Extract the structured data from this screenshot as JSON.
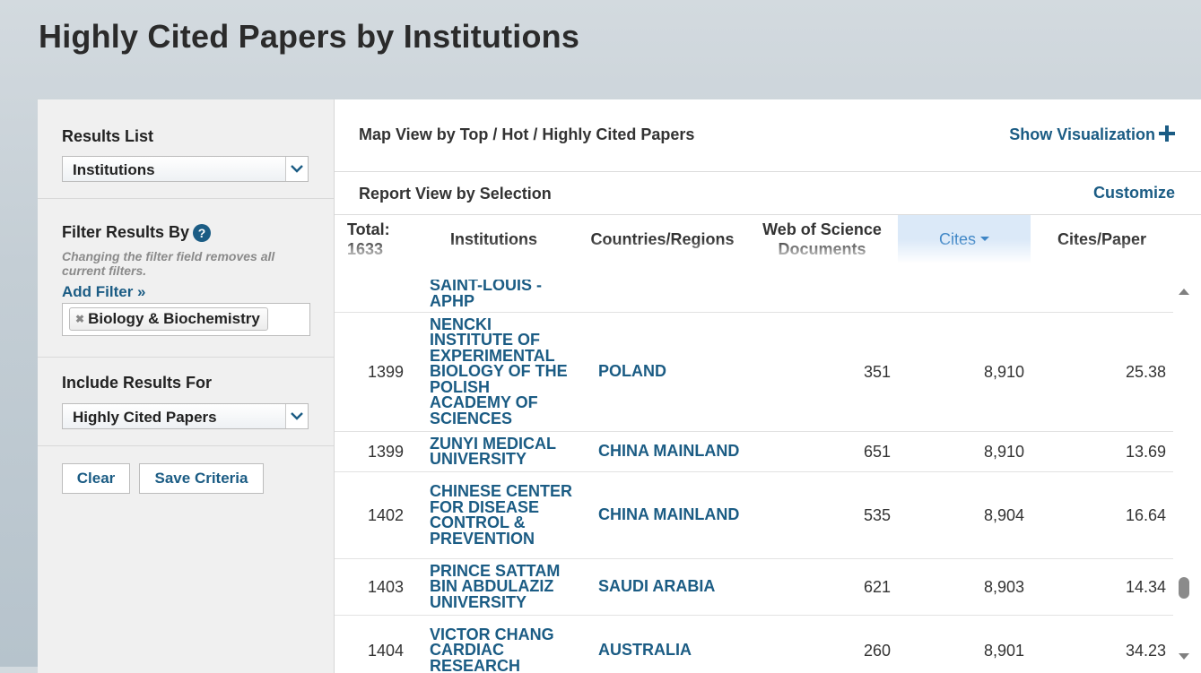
{
  "page": {
    "title": "Highly Cited Papers by Institutions"
  },
  "sidebar": {
    "results_list": {
      "label": "Results List",
      "selected": "Institutions"
    },
    "filter": {
      "label": "Filter Results By",
      "help": "?",
      "note": "Changing the filter field removes all current filters.",
      "add_filter": "Add Filter »",
      "active_filter": "Biology & Biochemistry"
    },
    "include": {
      "label": "Include Results For",
      "selected": "Highly Cited Papers"
    },
    "buttons": {
      "clear": "Clear",
      "save": "Save Criteria"
    }
  },
  "main": {
    "map_view": "Map View by Top / Hot / Highly Cited Papers",
    "show_visualization": "Show Visualization",
    "report_view": "Report View by Selection",
    "customize": "Customize"
  },
  "table": {
    "total_label": "Total:",
    "total_value": "1633",
    "columns": {
      "institutions": "Institutions",
      "countries": "Countries/Regions",
      "wos_docs": "Web of Science Documents",
      "cites": "Cites",
      "cites_per_paper": "Cites/Paper"
    },
    "partial_row": {
      "institution": "SAINT-LOUIS - APHP"
    },
    "rows": [
      {
        "rank": "1399",
        "institution": "NENCKI INSTITUTE OF EXPERIMENTAL BIOLOGY OF THE POLISH ACADEMY OF SCIENCES",
        "country": "POLAND",
        "docs": "351",
        "cites": "8,910",
        "cpp": "25.38"
      },
      {
        "rank": "1399",
        "institution": "ZUNYI MEDICAL UNIVERSITY",
        "country": "CHINA MAINLAND",
        "docs": "651",
        "cites": "8,910",
        "cpp": "13.69"
      },
      {
        "rank": "1402",
        "institution": "CHINESE CENTER FOR DISEASE CONTROL & PREVENTION",
        "country": "CHINA MAINLAND",
        "docs": "535",
        "cites": "8,904",
        "cpp": "16.64"
      },
      {
        "rank": "1403",
        "institution": "PRINCE SATTAM BIN ABDULAZIZ UNIVERSITY",
        "country": "SAUDI ARABIA",
        "docs": "621",
        "cites": "8,903",
        "cpp": "14.34"
      },
      {
        "rank": "1404",
        "institution": "VICTOR CHANG CARDIAC RESEARCH",
        "country": "AUSTRALIA",
        "docs": "260",
        "cites": "8,901",
        "cpp": "34.23"
      }
    ]
  },
  "colors": {
    "link": "#1b5c84",
    "selected_header_bg": "#dbe9f8",
    "selected_header_text": "#3f86c6"
  }
}
